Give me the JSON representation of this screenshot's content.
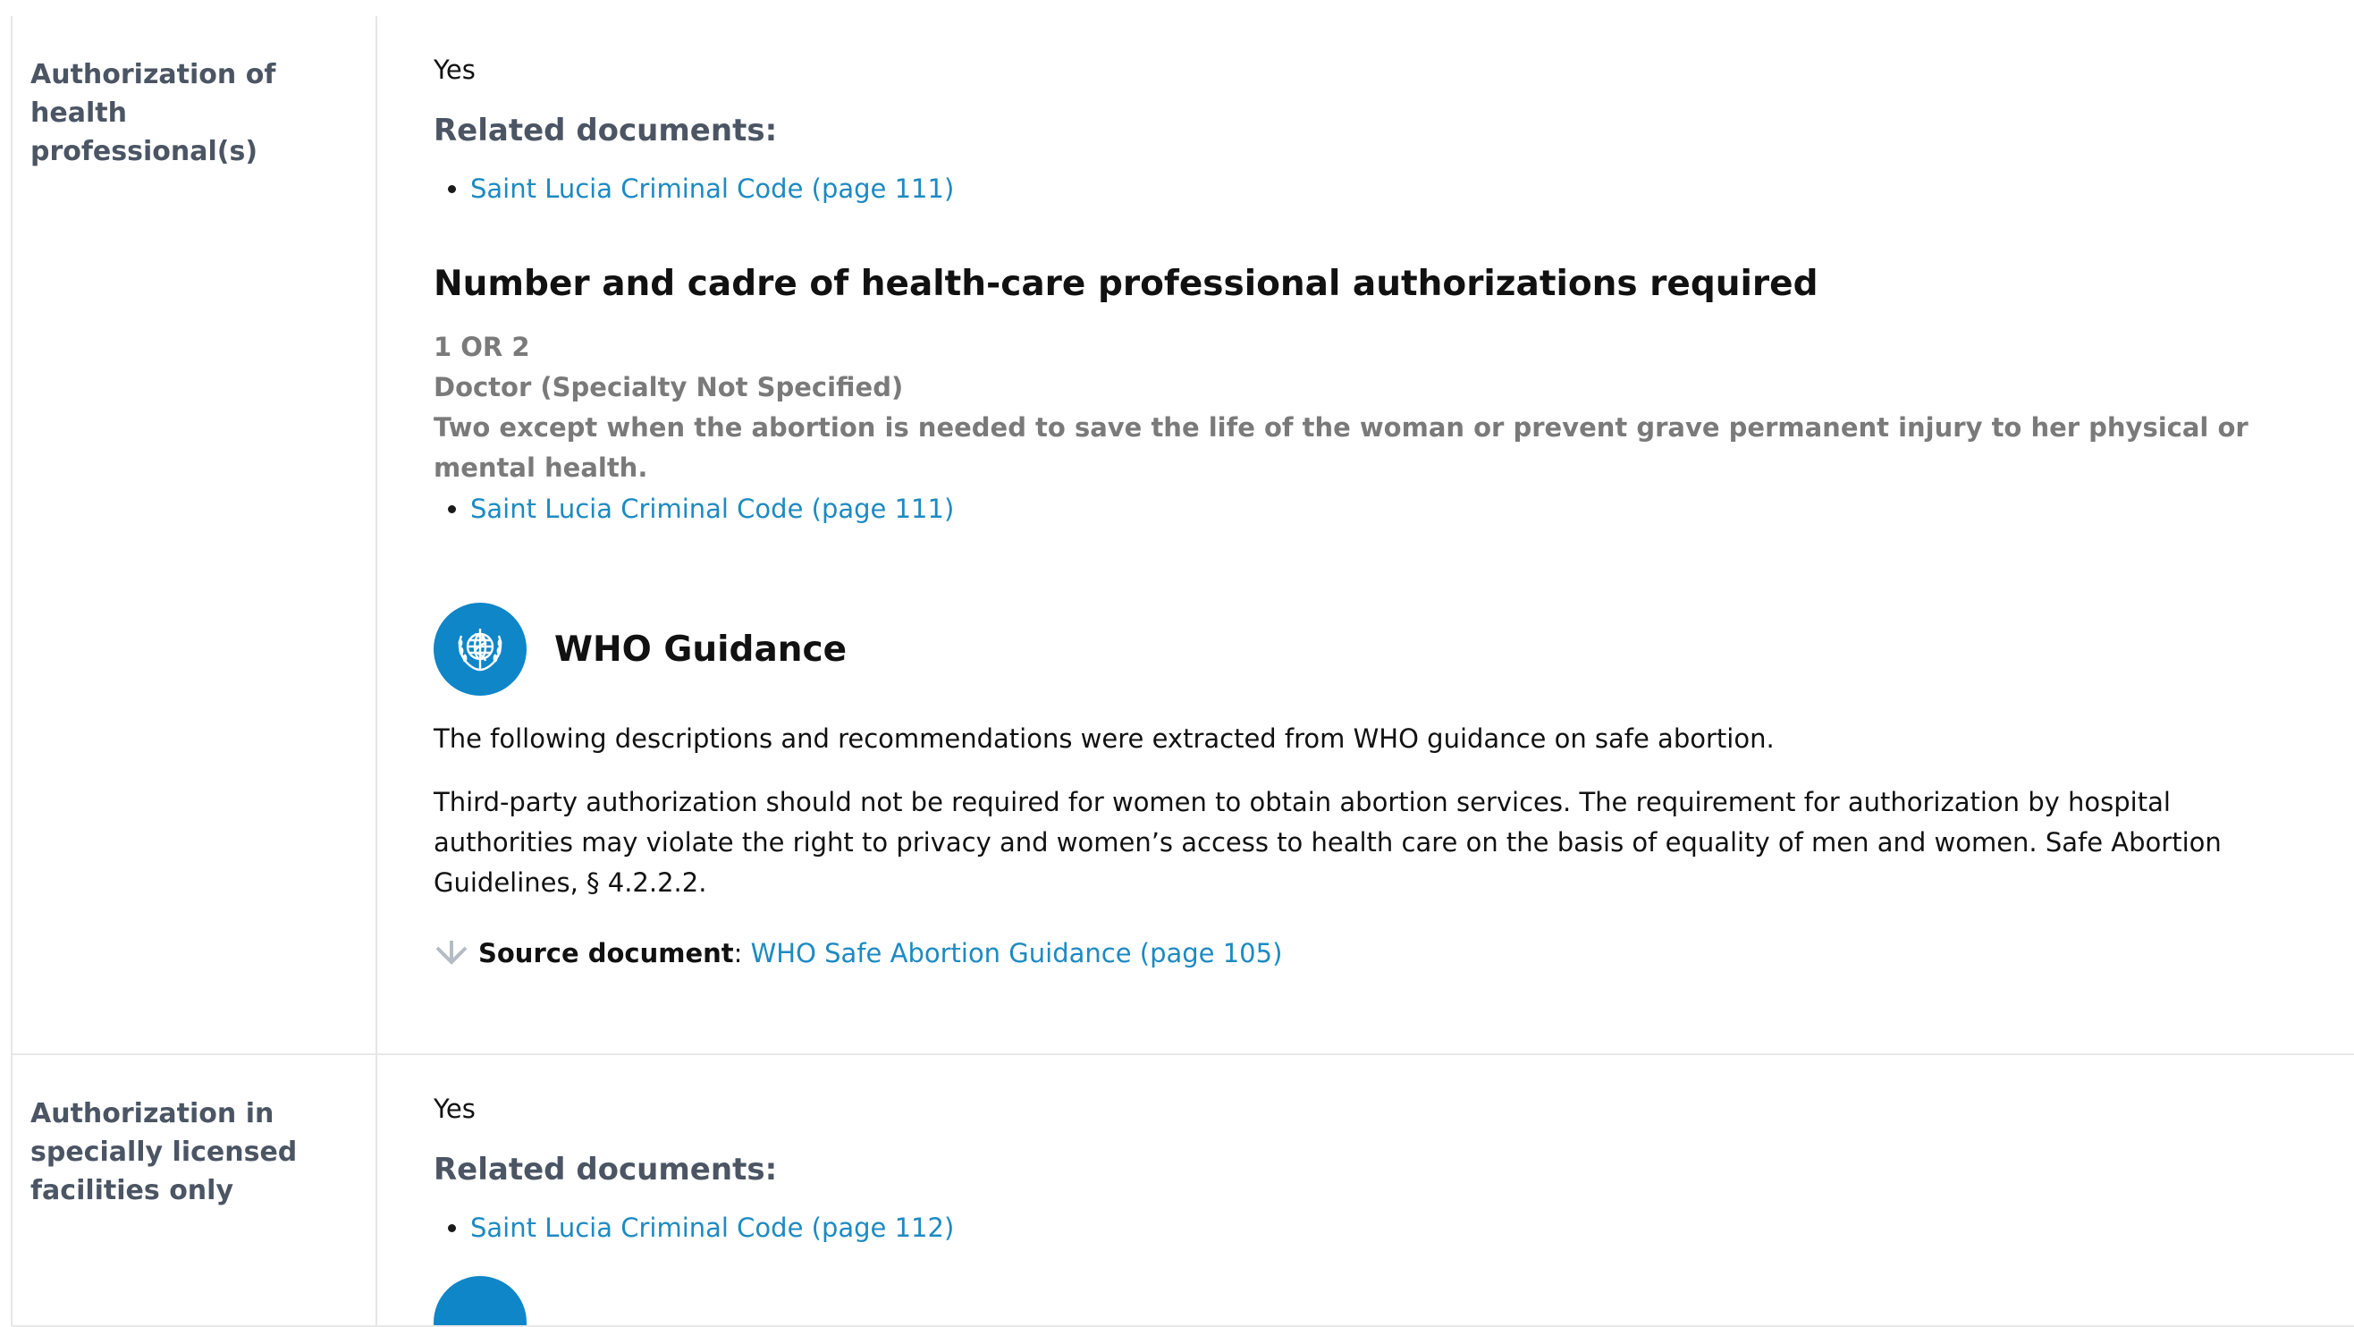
{
  "rows": [
    {
      "label": "Authorization of health professional(s)",
      "answer": "Yes",
      "related_heading": "Related documents:",
      "related_docs": [
        "Saint Lucia Criminal Code (page 111)"
      ],
      "subsection": {
        "title": "Number and cadre of health-care professional authorizations required",
        "lines": [
          "1 OR 2",
          "Doctor (Specialty Not Specified)",
          "Two except when the abortion is needed to save the life of the woman or prevent grave permanent injury to her physical or mental health."
        ],
        "docs": [
          "Saint Lucia Criminal Code (page 111)"
        ]
      },
      "who": {
        "title": "WHO Guidance",
        "intro": "The following descriptions and recommendations were extracted from WHO guidance on safe abortion.",
        "body": "Third-party authorization should not be required for women to obtain abortion services. The requirement for authorization by hospital authorities may violate the right to privacy and women’s access to health care on the basis of equality of men and women. Safe Abortion Guidelines, § 4.2.2.2.",
        "source_label": "Source document",
        "source_sep": ":",
        "source_link": "WHO Safe Abortion Guidance (page 105)"
      }
    },
    {
      "label": "Authorization in specially licensed facilities only",
      "answer": "Yes",
      "related_heading": "Related documents:",
      "related_docs": [
        "Saint Lucia Criminal Code (page 112)"
      ]
    }
  ],
  "colors": {
    "link": "#1d8ac2",
    "label": "#4b5563",
    "muted": "#7a7a7a",
    "who_blue": "#0e86c8"
  },
  "icons": {
    "who": "who-emblem-icon",
    "source": "down-arrow-icon"
  }
}
